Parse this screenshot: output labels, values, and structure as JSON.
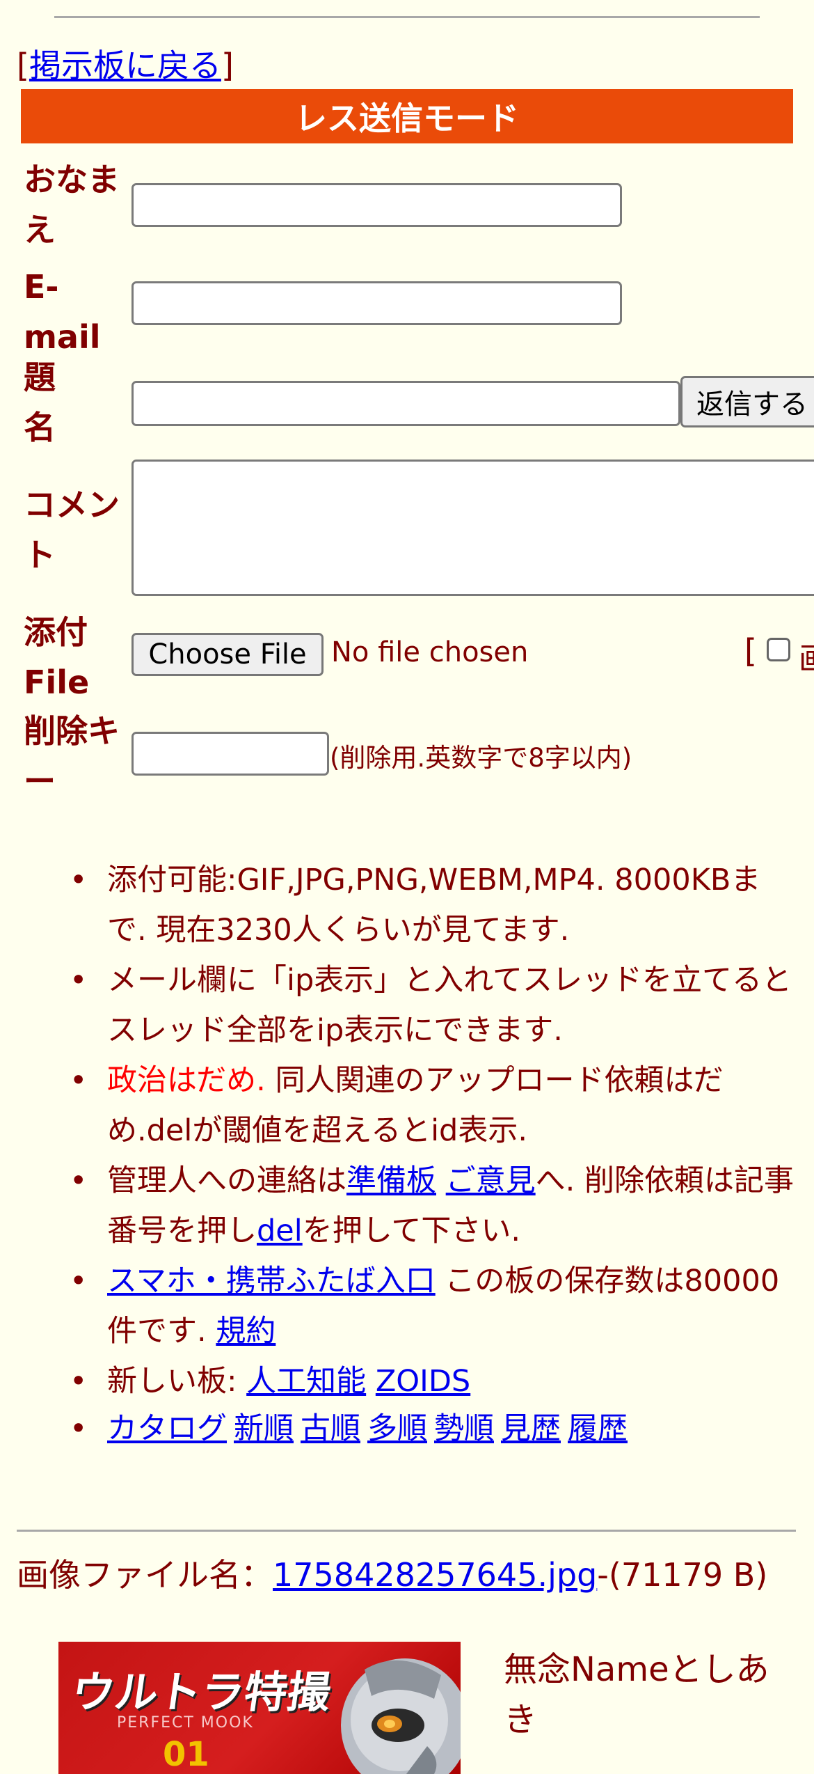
{
  "nav": {
    "back_link": "掲示板に戻る",
    "bracket_open": "[",
    "bracket_close": "]"
  },
  "form": {
    "mode_title": "レス送信モード",
    "labels": {
      "name": "おなまえ",
      "email": "E-mail",
      "subject": "題名",
      "comment": "コメント",
      "attach": "添付File",
      "delete_key": "削除キー"
    },
    "submit_label": "返信する",
    "file_button": "Choose File",
    "file_status": "No file chosen",
    "image_bracket": "[",
    "image_cut_label": "画",
    "delete_key_note": "(削除用.英数字で8字以内)"
  },
  "info": {
    "item1": "添付可能:GIF,JPG,PNG,WEBM,MP4. 8000KBまで. 現在3230人くらいが見てます.",
    "item2": "メール欄に「ip表示」と入れてスレッドを立てるとスレッド全部をip表示にできます.",
    "item3_red": "政治はだめ.",
    "item3_rest": " 同人関連のアップロード依頼はだめ.delが閾値を超えるとid表示.",
    "item4_pre": "管理人への連絡は",
    "item4_link1": "準備板",
    "item4_link2": "ご意見",
    "item4_mid": "へ. 削除依頼は記事番号を押し",
    "item4_link3": "del",
    "item4_post": "を押して下さい.",
    "item5_link": "スマホ・携帯ふたば入口",
    "item5_mid": " この板の保存数は80000件です. ",
    "item5_link2": "規約",
    "item6_label": "新しい板: ",
    "item6_link1": "人工知能",
    "item6_link2": "ZOIDS",
    "item7_links": [
      "カタログ",
      "新順",
      "古順",
      "多順",
      "勢順",
      "見歴",
      "履歴"
    ]
  },
  "post": {
    "file_label": "画像ファイル名：",
    "file_name": "1758428257645.jpg",
    "file_size": "-(71179 B)",
    "name_text": "無念Nameとしあき",
    "thumb_title": "ウルトラ特撮",
    "thumb_sub": "PERFECT MOOK",
    "thumb_num": "01"
  },
  "colors": {
    "background": "#ffffee",
    "text": "#800000",
    "accent": "#ea4b09",
    "link": "#0000ee",
    "warning": "#ff0000"
  }
}
